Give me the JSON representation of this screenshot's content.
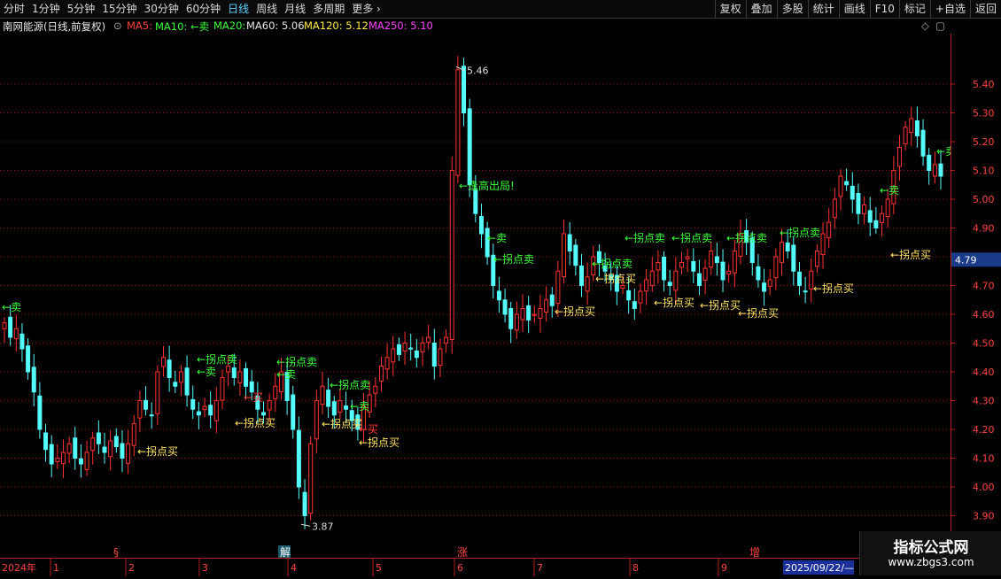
{
  "toolbar": {
    "periods": [
      "分时",
      "1分钟",
      "5分钟",
      "15分钟",
      "30分钟",
      "60分钟",
      "日线",
      "周线",
      "月线",
      "多周期",
      "更多"
    ],
    "active_period": "日线",
    "tools": [
      "复权",
      "叠加",
      "多股",
      "统计",
      "画线",
      "F10",
      "标记",
      "+自选",
      "返回"
    ]
  },
  "header": {
    "stock": "南网能源(日线,前复权)",
    "ma5": "MA5:",
    "ma10": "MA10: ←卖",
    "ma20": "MA20:",
    "ma60": "MA60: 5.06",
    "ma120": "MA120: 5.12",
    "ma250": "MA250: 5.10"
  },
  "colors": {
    "up": "#ff3232",
    "down": "#54fcfc",
    "sell": "#3cff3c",
    "buy": "#ffe566",
    "grid": "#7a1010",
    "axis": "#b02020"
  },
  "price_axis": {
    "ticks": [
      "5.40",
      "5.30",
      "5.20",
      "5.10",
      "5.00",
      "4.90",
      "4.80",
      "4.70",
      "4.60",
      "4.50",
      "4.40",
      "4.30",
      "4.20",
      "4.10",
      "4.00",
      "3.90"
    ],
    "current": "4.79"
  },
  "time_axis": {
    "year": "2024年",
    "months": [
      "1",
      "2",
      "3",
      "4",
      "5",
      "6",
      "7",
      "8",
      "9"
    ],
    "cursor_date": "2025/09/22/—"
  },
  "event_markers": [
    "§",
    "解",
    "涨",
    "增"
  ],
  "chart_data": {
    "type": "candlestick",
    "high": {
      "value": "5.46"
    },
    "low": {
      "value": "3.87"
    },
    "signals": [
      {
        "text": "←卖",
        "kind": "sell"
      },
      {
        "text": "←拐点买",
        "kind": "buy"
      },
      {
        "text": "←拐点卖",
        "kind": "sell"
      },
      {
        "text": "←卖",
        "kind": "sell"
      },
      {
        "text": "←拐点买",
        "kind": "buy"
      },
      {
        "text": "←拐点卖",
        "kind": "sell"
      },
      {
        "text": "←卖",
        "kind": "sell"
      },
      {
        "text": "←买",
        "kind": "buyred"
      },
      {
        "text": "←拐点卖",
        "kind": "sell"
      },
      {
        "text": "←拐点买",
        "kind": "buy"
      },
      {
        "text": "←买",
        "kind": "buyred"
      },
      {
        "text": "←拐点买",
        "kind": "buy"
      },
      {
        "text": "←卖",
        "kind": "sell"
      },
      {
        "text": "←逢高出局!",
        "kind": "sell"
      },
      {
        "text": "←卖",
        "kind": "sell"
      },
      {
        "text": "←拐点卖",
        "kind": "sell"
      },
      {
        "text": "←拐点买",
        "kind": "buy"
      },
      {
        "text": "←拐点卖",
        "kind": "sell"
      },
      {
        "text": "←拐点买",
        "kind": "buy"
      },
      {
        "text": "←拐点卖",
        "kind": "sell"
      },
      {
        "text": "←拐点买",
        "kind": "buy"
      },
      {
        "text": "←拐点卖",
        "kind": "sell"
      },
      {
        "text": "←拐点买",
        "kind": "buy"
      },
      {
        "text": "←拐点卖",
        "kind": "sell"
      },
      {
        "text": "←拐点买",
        "kind": "buy"
      },
      {
        "text": "←拐点卖",
        "kind": "sell"
      },
      {
        "text": "←拐点买",
        "kind": "buy"
      },
      {
        "text": "←卖",
        "kind": "sell"
      }
    ]
  },
  "watermark": {
    "title": "指标公式网",
    "url": "www.zbgs3.com"
  }
}
